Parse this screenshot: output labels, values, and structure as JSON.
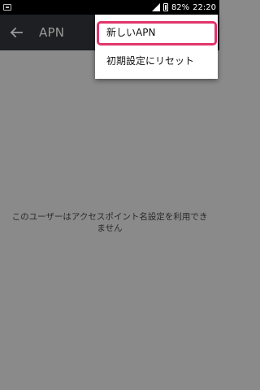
{
  "status_bar": {
    "battery": "82%",
    "time": "22:20",
    "icons": [
      "notification-icon",
      "signal-icon",
      "battery-icon"
    ]
  },
  "action_bar": {
    "title": "APN",
    "back_icon": "arrow-back-icon"
  },
  "content": {
    "empty_message": "このユーザーはアクセスポイント名設定を利用できません"
  },
  "menu": {
    "items": [
      {
        "label": "新しいAPN"
      },
      {
        "label": "初期設定にリセット"
      }
    ]
  },
  "colors": {
    "highlight": "#e0356b",
    "background_dim": "#8a8a8a",
    "action_bar": "#1d1f22"
  }
}
